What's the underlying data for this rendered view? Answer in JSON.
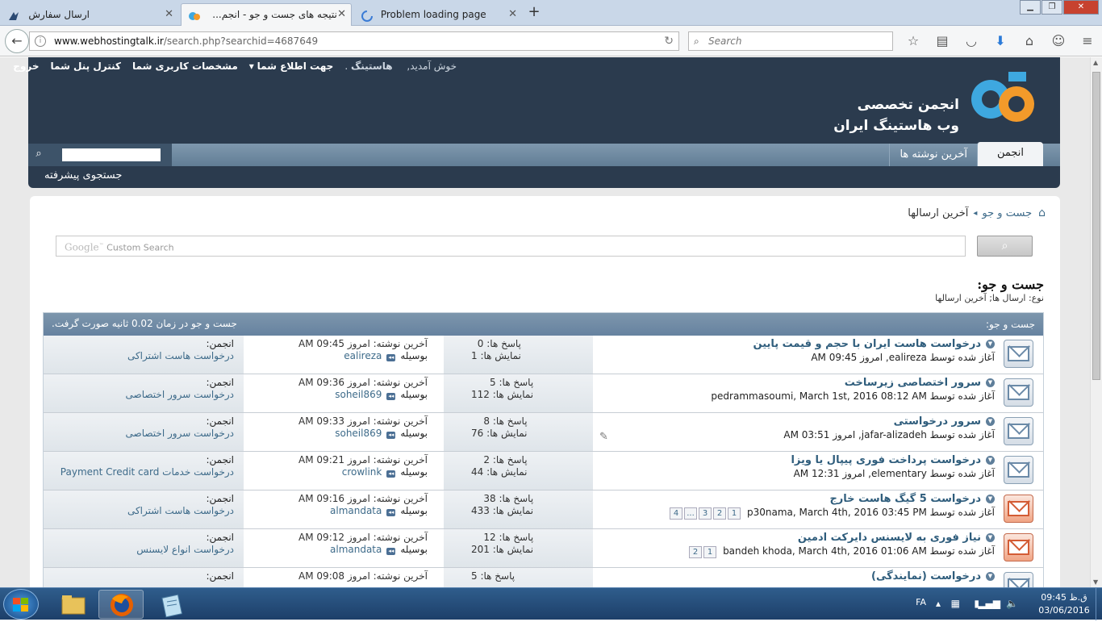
{
  "browser": {
    "tabs": [
      {
        "title": "ارسال سفارش",
        "active": false
      },
      {
        "title": "نتیجه های جست و جو - انجم...",
        "active": true
      },
      {
        "title": "Problem loading page",
        "active": false
      }
    ],
    "url_host": "www.webhostingtalk.ir",
    "url_path": "/search.php?searchid=4687649",
    "search_placeholder": "Search"
  },
  "header": {
    "welcome": "خوش آمدید,",
    "username": "هاستینگ",
    "notifications": "جهت اطلاع شما",
    "profile": "مشخصات کاربری شما",
    "usercp": "کنترل پنل شما",
    "logout": "خروج",
    "logo_line1": "انجمن تخصصی",
    "logo_line2": "وب هاستینگ ایران",
    "nav_forum": "انجمن",
    "nav_latest": "آخرین نوشته ها",
    "advanced_search": "جستجوی پیشرفته"
  },
  "breadcrumb": {
    "search": "جست و جو",
    "current": "آخرین ارسالها"
  },
  "google": {
    "brand": "Google",
    "tm": "™",
    "label": "Custom Search"
  },
  "page": {
    "title": "جست و جو:",
    "type_label": "نوع: ارسال ها; آخرین ارسالها",
    "table_header_right": "جست و جو:",
    "table_header_left": "جست و جو در زمان 0.02 ثانیه صورت گرفت."
  },
  "labels": {
    "started_by": "آغاز شده توسط",
    "replies": "پاسخ ها:",
    "views": "نمایش ها:",
    "last_post": "آخرین نوشته:",
    "by": "بوسیله",
    "forum": "انجمن:"
  },
  "threads": [
    {
      "title": "درخواست هاست ایران با حجم و قیمت پایین",
      "starter": "ealireza, امروز 09:45 AM",
      "pages": [],
      "replies": "0",
      "views": "1",
      "last_time": "امروز 09:45 AM",
      "last_user": "ealireza",
      "forum": "درخواست هاست اشتراکی",
      "hot": false,
      "attach": false
    },
    {
      "title": "سرور اختصاصی زیرساخت",
      "starter": "pedrammasoumi, March 1st, 2016 08:12 AM",
      "pages": [],
      "replies": "5",
      "views": "112",
      "last_time": "امروز 09:36 AM",
      "last_user": "soheil869",
      "forum": "درخواست سرور اختصاصی",
      "hot": false,
      "attach": false
    },
    {
      "title": "سرور درخواستی",
      "starter": "jafar-alizadeh, امروز 03:51 AM",
      "pages": [],
      "replies": "8",
      "views": "76",
      "last_time": "امروز 09:33 AM",
      "last_user": "soheil869",
      "forum": "درخواست سرور اختصاصی",
      "hot": false,
      "attach": true
    },
    {
      "title": "درخواست پرداخت فوری پیپال یا ویزا",
      "starter": "elementary, امروز 12:31 AM",
      "pages": [],
      "replies": "2",
      "views": "44",
      "last_time": "امروز 09:21 AM",
      "last_user": "crowlink",
      "forum": "درخواست خدمات Payment Credit card",
      "hot": false,
      "attach": false
    },
    {
      "title": "درخواست 5 گیگ هاست خارج",
      "starter": "p30nama, March 4th, 2016 03:45 PM",
      "pages": [
        "1",
        "2",
        "3",
        "...",
        "4"
      ],
      "replies": "38",
      "views": "433",
      "last_time": "امروز 09:16 AM",
      "last_user": "almandata",
      "forum": "درخواست هاست اشتراکی",
      "hot": true,
      "attach": false
    },
    {
      "title": "نیاز فوری به لایسنس دایرکت ادمین",
      "starter": "bandeh khoda, March 4th, 2016 01:06 AM",
      "pages": [
        "1",
        "2"
      ],
      "replies": "12",
      "views": "201",
      "last_time": "امروز 09:12 AM",
      "last_user": "almandata",
      "forum": "درخواست انواع لایسنس",
      "hot": true,
      "attach": false
    },
    {
      "title": "درخواست (نمایندگی)",
      "starter": "",
      "pages": [],
      "replies": "5",
      "views": "",
      "last_time": "امروز 09:08 AM",
      "last_user": "",
      "forum": "",
      "hot": false,
      "attach": false
    }
  ],
  "taskbar": {
    "lang": "FA",
    "time": "ق.ظ 09:45",
    "date": "03/06/2016"
  }
}
